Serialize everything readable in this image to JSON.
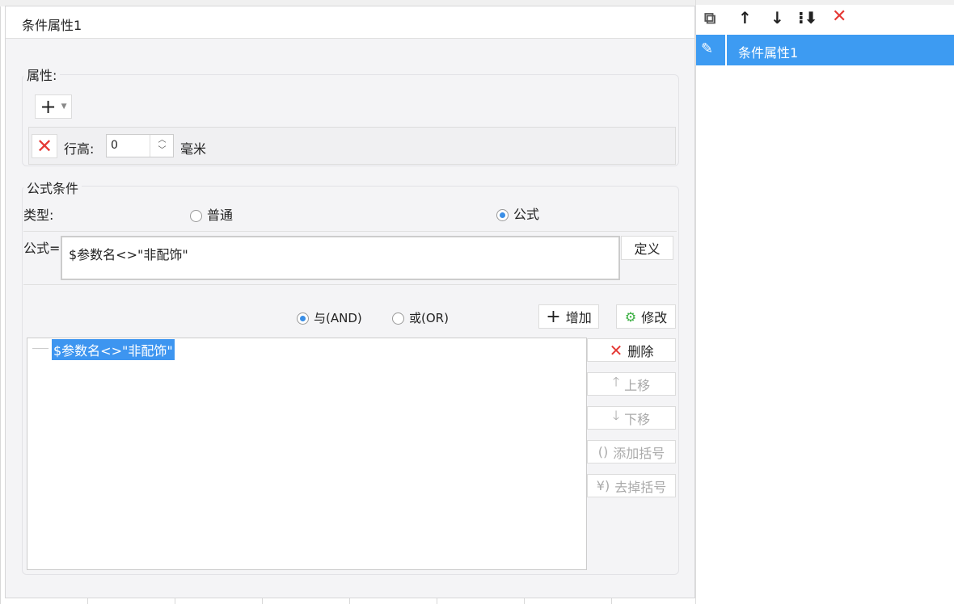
{
  "dialog": {
    "title": "条件属性1"
  },
  "attributes": {
    "legend": "属性:",
    "row_height_label": "行高:",
    "row_height_value": "0",
    "unit": "毫米"
  },
  "formula_condition": {
    "legend": "公式条件",
    "type_label": "类型:",
    "type_options": [
      "普通",
      "公式"
    ],
    "type_selected": "公式",
    "formula_label": "公式=",
    "formula_value": "$参数名<>\"非配饰\"",
    "define_button": "定义",
    "logic_options": [
      "与(AND)",
      "或(OR)"
    ],
    "logic_selected": "与(AND)",
    "add_button": "增加",
    "modify_button": "修改",
    "conditions": [
      "$参数名<>\"非配饰\""
    ],
    "delete_button": "删除",
    "move_up_button": "上移",
    "move_down_button": "下移",
    "add_bracket_button": "添加括号",
    "remove_bracket_button": "去掉括号"
  },
  "right_panel": {
    "items": [
      "条件属性1"
    ],
    "selected": "条件属性1"
  }
}
